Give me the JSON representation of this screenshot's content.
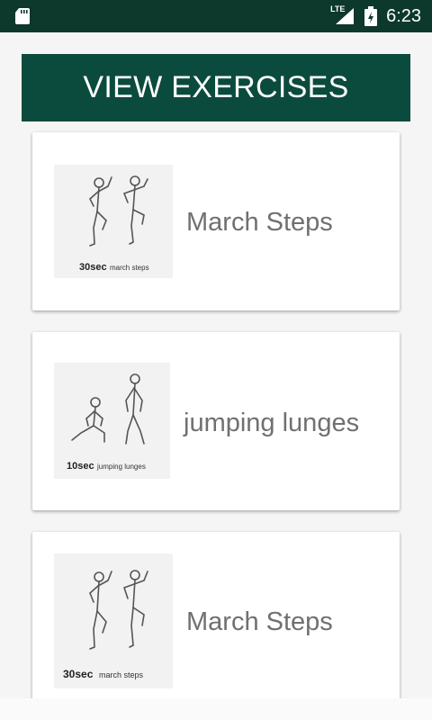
{
  "status_bar": {
    "network": "LTE",
    "time": "6:23"
  },
  "header": {
    "title": "VIEW EXERCISES"
  },
  "exercises": [
    {
      "name": "March Steps",
      "thumb_caption_bold": "30sec",
      "thumb_caption": "march steps",
      "thumb_icon": "march-steps-illustration"
    },
    {
      "name": "jumping lunges",
      "thumb_caption_bold": "10sec",
      "thumb_caption": "jumping lunges",
      "thumb_icon": "jumping-lunges-illustration"
    },
    {
      "name": "March Steps",
      "thumb_caption_bold": "30sec",
      "thumb_caption": "march steps",
      "thumb_icon": "march-steps-illustration"
    }
  ]
}
